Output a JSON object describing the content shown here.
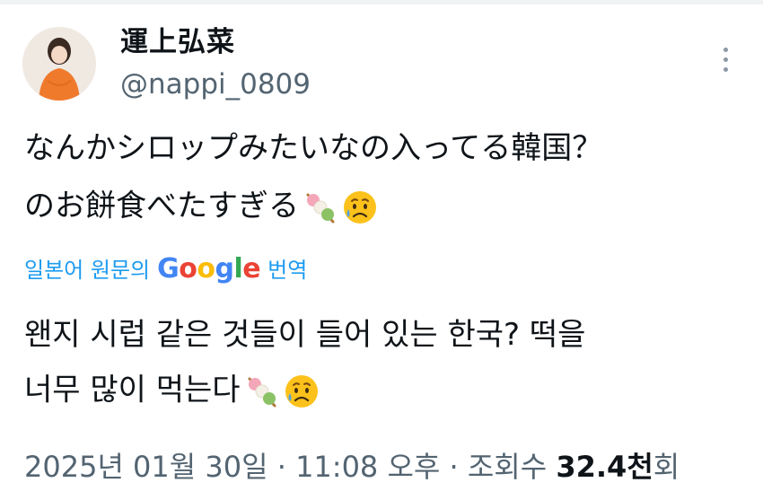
{
  "user": {
    "display_name": "運上弘菜",
    "handle": "@nappi_0809"
  },
  "tweet": {
    "original_line_1": "なんかシロップみたいなの入ってる韓国？",
    "original_line_2": "のお餅食べたすぎる"
  },
  "translation": {
    "prefix": "일본어 원문의",
    "brand": "Google",
    "suffix": "번역",
    "line_1": "왠지 시럽 같은 것들이 들어 있는 한국? 떡을",
    "line_2": "너무 많이 먹는다"
  },
  "emojis": [
    "dango-icon",
    "sad-relieved-face-icon"
  ],
  "meta": {
    "date": "2025년 01월 30일",
    "sep1": " · ",
    "time": "11:08 오후",
    "sep2": " · ",
    "views_label": "조회수 ",
    "views_count": "32.4",
    "views_unit": "천",
    "views_suffix": "회"
  },
  "colors": {
    "text": "#0f1419",
    "secondary": "#536471",
    "link": "#1d9bf0"
  }
}
